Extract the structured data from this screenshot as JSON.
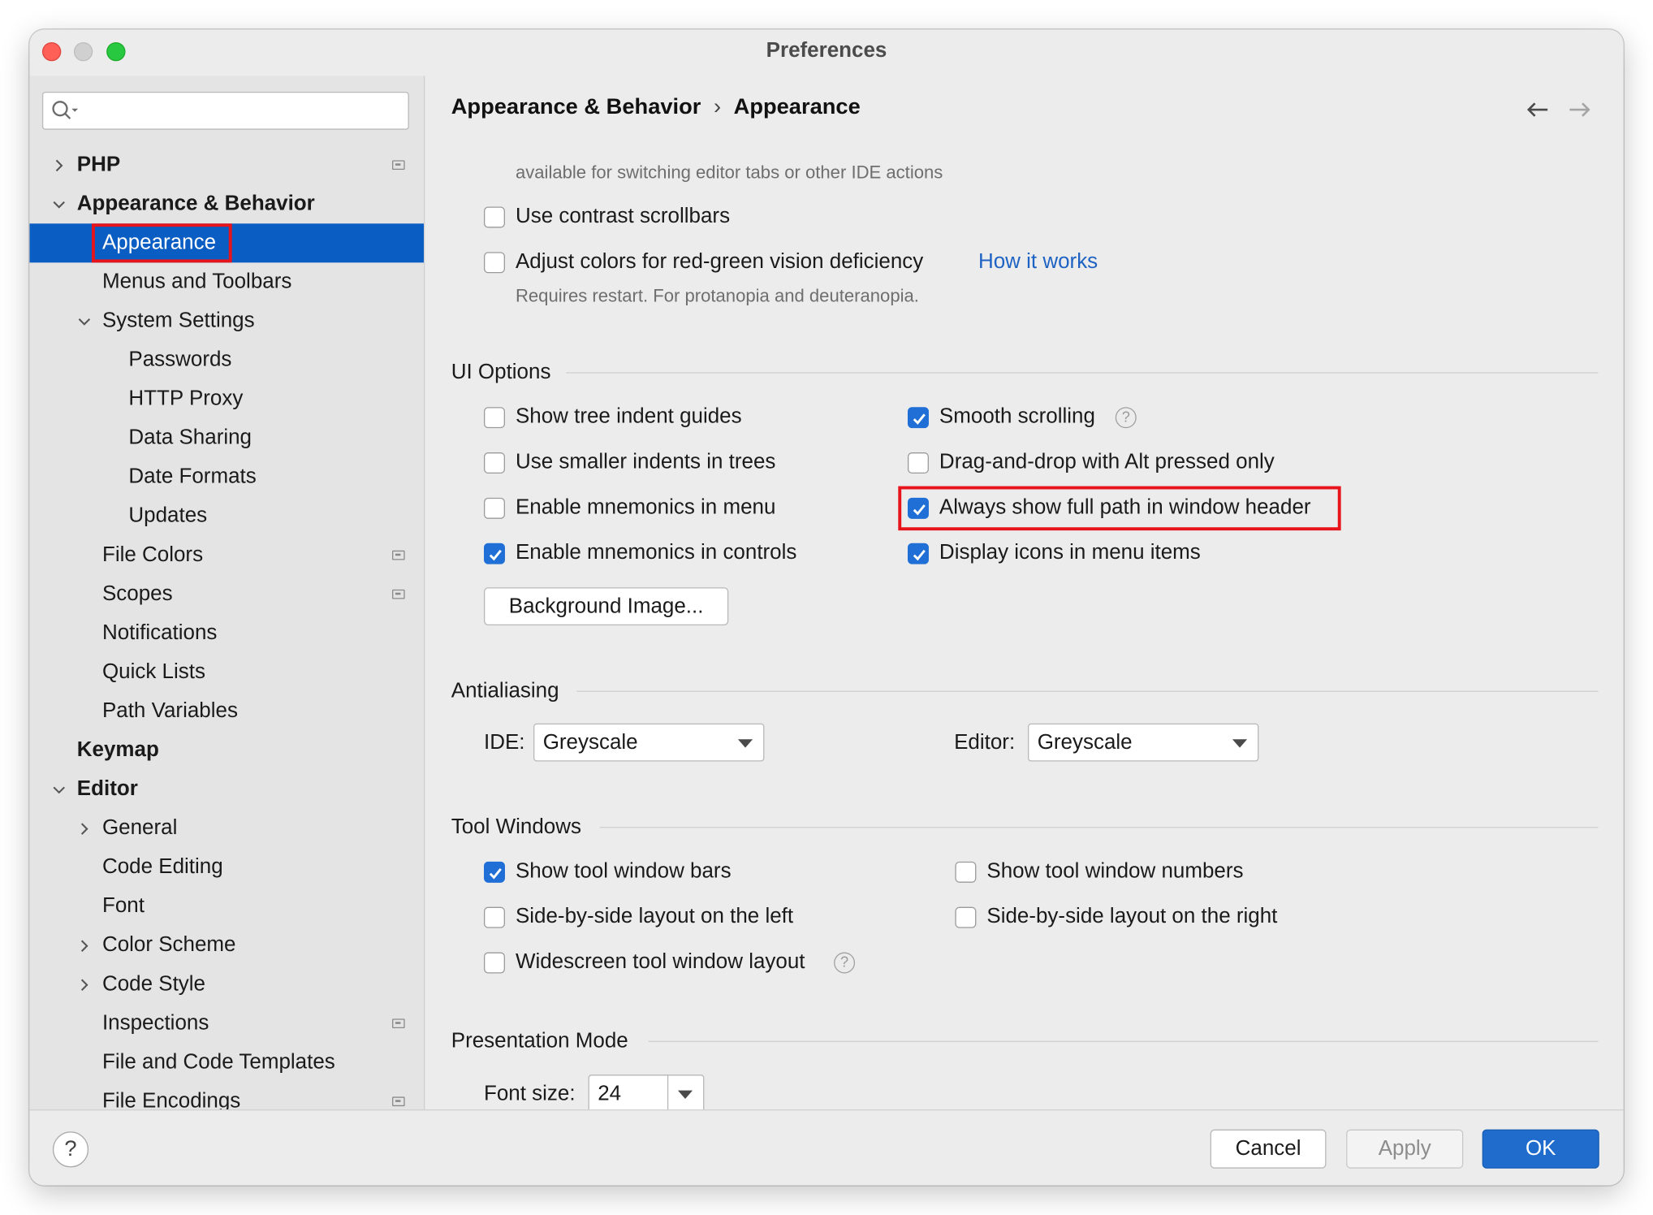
{
  "window": {
    "title": "Preferences"
  },
  "sidebar": {
    "search_placeholder": "",
    "items": [
      {
        "label": "PHP",
        "level": 0,
        "chevron": "right",
        "bold": true,
        "project_icon": true
      },
      {
        "label": "Appearance & Behavior",
        "level": 0,
        "chevron": "down",
        "bold": true
      },
      {
        "label": "Appearance",
        "level": 1,
        "selected": true
      },
      {
        "label": "Menus and Toolbars",
        "level": 1
      },
      {
        "label": "System Settings",
        "level": 1,
        "chevron": "down"
      },
      {
        "label": "Passwords",
        "level": 2
      },
      {
        "label": "HTTP Proxy",
        "level": 2
      },
      {
        "label": "Data Sharing",
        "level": 2
      },
      {
        "label": "Date Formats",
        "level": 2
      },
      {
        "label": "Updates",
        "level": 2
      },
      {
        "label": "File Colors",
        "level": 1,
        "project_icon": true
      },
      {
        "label": "Scopes",
        "level": 1,
        "project_icon": true
      },
      {
        "label": "Notifications",
        "level": 1
      },
      {
        "label": "Quick Lists",
        "level": 1
      },
      {
        "label": "Path Variables",
        "level": 1
      },
      {
        "label": "Keymap",
        "level": 0,
        "bold": true
      },
      {
        "label": "Editor",
        "level": 0,
        "chevron": "down",
        "bold": true
      },
      {
        "label": "General",
        "level": 1,
        "chevron": "right"
      },
      {
        "label": "Code Editing",
        "level": 1
      },
      {
        "label": "Font",
        "level": 1
      },
      {
        "label": "Color Scheme",
        "level": 1,
        "chevron": "right"
      },
      {
        "label": "Code Style",
        "level": 1,
        "chevron": "right"
      },
      {
        "label": "Inspections",
        "level": 1,
        "project_icon": true
      },
      {
        "label": "File and Code Templates",
        "level": 1
      },
      {
        "label": "File Encodings",
        "level": 1,
        "project_icon": true
      }
    ]
  },
  "breadcrumb": {
    "parent": "Appearance & Behavior",
    "separator": "›",
    "current": "Appearance"
  },
  "content": {
    "cut_hint": "available for switching editor tabs or other IDE actions",
    "contrast_scrollbars": {
      "label": "Use contrast scrollbars",
      "checked": false
    },
    "red_green": {
      "label": "Adjust colors for red-green vision deficiency",
      "checked": false
    },
    "how_it_works": "How it works",
    "red_green_hint": "Requires restart. For protanopia and deuteranopia.",
    "ui_options": {
      "title": "UI Options",
      "left": [
        {
          "label": "Show tree indent guides",
          "checked": false
        },
        {
          "label": "Use smaller indents in trees",
          "checked": false
        },
        {
          "label": "Enable mnemonics in menu",
          "checked": false
        },
        {
          "label": "Enable mnemonics in controls",
          "checked": true
        }
      ],
      "right": [
        {
          "label": "Smooth scrolling",
          "checked": true,
          "help": true
        },
        {
          "label": "Drag-and-drop with Alt pressed only",
          "checked": false
        },
        {
          "label": "Always show full path in window header",
          "checked": true,
          "highlighted": true
        },
        {
          "label": "Display icons in menu items",
          "checked": true
        }
      ],
      "background_button": "Background Image..."
    },
    "antialiasing": {
      "title": "Antialiasing",
      "ide_label": "IDE:",
      "ide_value": "Greyscale",
      "editor_label": "Editor:",
      "editor_value": "Greyscale"
    },
    "tool_windows": {
      "title": "Tool Windows",
      "left": [
        {
          "label": "Show tool window bars",
          "checked": true
        },
        {
          "label": "Side-by-side layout on the left",
          "checked": false
        },
        {
          "label": "Widescreen tool window layout",
          "checked": false,
          "help": true
        }
      ],
      "right": [
        {
          "label": "Show tool window numbers",
          "checked": false
        },
        {
          "label": "Side-by-side layout on the right",
          "checked": false
        }
      ]
    },
    "presentation": {
      "title": "Presentation Mode",
      "font_size_label": "Font size:",
      "font_size_value": "24"
    }
  },
  "buttons": {
    "help": "?",
    "cancel": "Cancel",
    "apply": "Apply",
    "ok": "OK",
    "apply_enabled": false
  },
  "colors": {
    "accent": "#1f6fd6",
    "selection": "#0a5dc2",
    "highlight_box": "#e8141c",
    "link": "#1e63c4"
  },
  "icons": [
    "search-icon",
    "back-arrow-icon",
    "forward-arrow-icon",
    "help-icon",
    "chevron-right-icon",
    "chevron-down-icon",
    "project-scope-icon",
    "checkmark-icon",
    "dropdown-arrow-icon"
  ]
}
